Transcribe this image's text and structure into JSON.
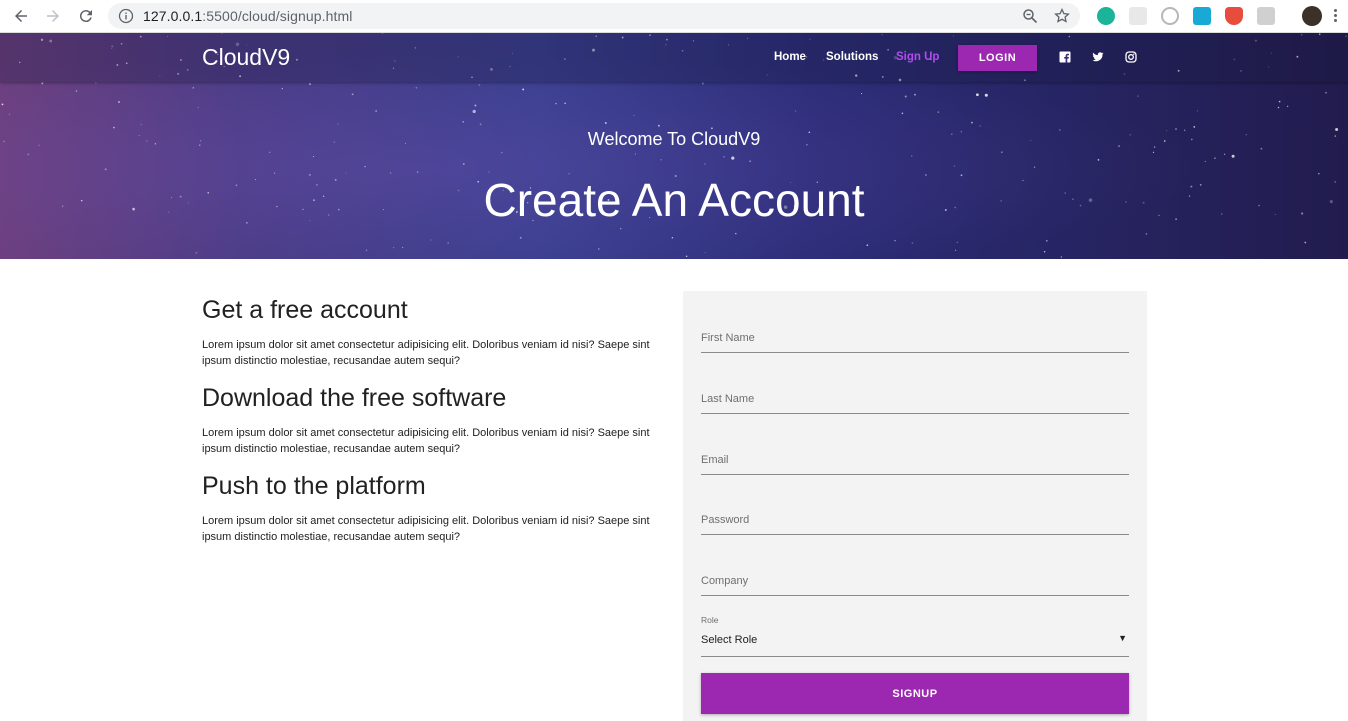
{
  "browser": {
    "url_host": "127.0.0.1",
    "url_rest": ":5500/cloud/signup.html"
  },
  "navbar": {
    "brand": "CloudV9",
    "links": [
      "Home",
      "Solutions",
      "Sign Up"
    ],
    "active_link": "Sign Up",
    "login_label": "LOGIN",
    "social_icons": [
      "facebook-icon",
      "twitter-icon",
      "instagram-icon"
    ]
  },
  "hero": {
    "welcome": "Welcome To CloudV9",
    "title": "Create An Account"
  },
  "features": [
    {
      "heading": "Get a free account",
      "text": "Lorem ipsum dolor sit amet consectetur adipisicing elit. Doloribus veniam id nisi? Saepe sint ipsum distinctio molestiae, recusandae autem sequi?"
    },
    {
      "heading": "Download the free software",
      "text": "Lorem ipsum dolor sit amet consectetur adipisicing elit. Doloribus veniam id nisi? Saepe sint ipsum distinctio molestiae, recusandae autem sequi?"
    },
    {
      "heading": "Push to the platform",
      "text": "Lorem ipsum dolor sit amet consectetur adipisicing elit. Doloribus veniam id nisi? Saepe sint ipsum distinctio molestiae, recusandae autem sequi?"
    }
  ],
  "form": {
    "first_name_placeholder": "First Name",
    "last_name_placeholder": "Last Name",
    "email_placeholder": "Email",
    "password_placeholder": "Password",
    "company_placeholder": "Company",
    "role_label": "Role",
    "role_value": "Select Role",
    "signup_label": "SIGNUP"
  },
  "colors": {
    "accent": "#9c27b0",
    "active_link": "#b34cf0",
    "form_bg": "#f3f3f3"
  }
}
